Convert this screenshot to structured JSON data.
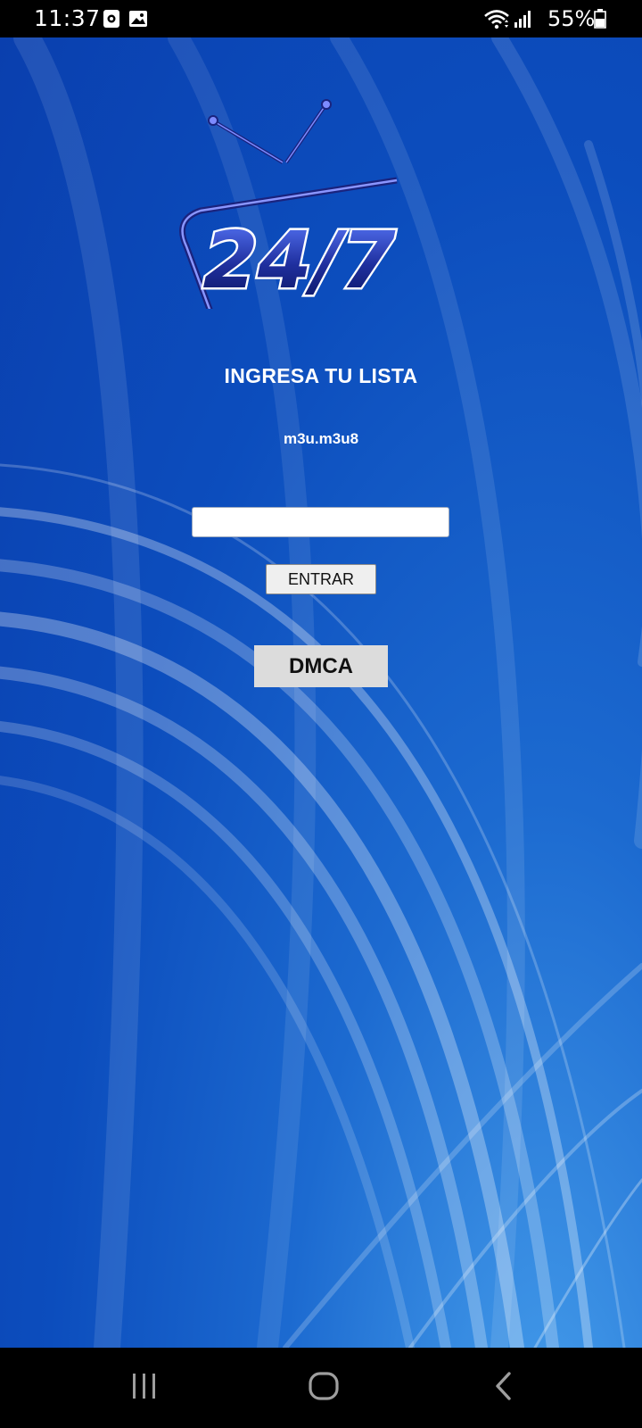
{
  "status_bar": {
    "time": "11:37",
    "battery": "55%",
    "icons": [
      "camera-notification-icon",
      "gallery-notification-icon",
      "wifi-icon",
      "signal-icon",
      "battery-icon"
    ]
  },
  "app": {
    "logo_text": "24/7",
    "title": "INGRESA TU LISTA",
    "subtitle": "m3u.m3u8",
    "input": {
      "value": "",
      "placeholder": ""
    },
    "enter_button_label": "ENTRAR",
    "dmca_button_label": "DMCA",
    "colors": {
      "background": "#0c4dbd",
      "button_gray": "#dcdcdc",
      "text": "#ffffff"
    }
  },
  "nav_bar": {
    "items": [
      "recent-apps-icon",
      "home-icon",
      "back-icon"
    ]
  }
}
